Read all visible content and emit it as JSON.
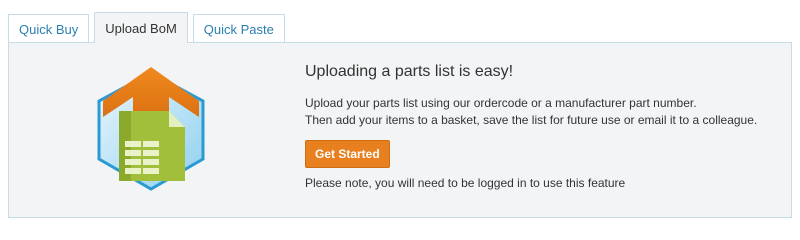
{
  "tabs": [
    {
      "label": "Quick Buy",
      "active": false
    },
    {
      "label": "Upload BoM",
      "active": true
    },
    {
      "label": "Quick Paste",
      "active": false
    }
  ],
  "panel": {
    "title": "Uploading a parts list is easy!",
    "description_line1": "Upload your parts list using our ordercode or a manufacturer part number.",
    "description_line2": "Then add your items to a basket, save the list for future use or email it to a colleague.",
    "button_label": "Get Started",
    "note": "Please note, you will need to be logged in to use this feature",
    "logo_icon": "upload-spreadsheet-icon"
  },
  "colors": {
    "accent_orange": "#e8801f",
    "tab_link": "#2a7fb0",
    "panel_bg": "#f3f4f5",
    "border": "#c7dbe8"
  }
}
